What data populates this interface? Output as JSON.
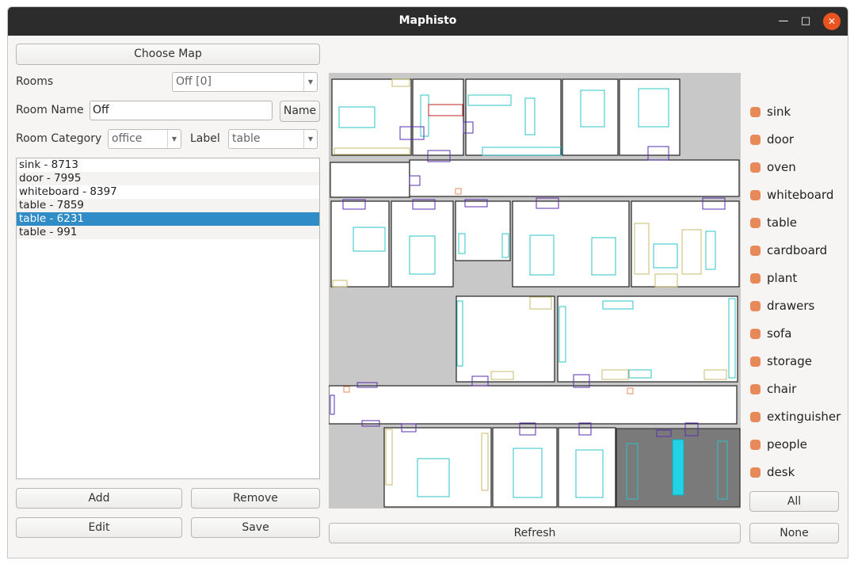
{
  "window": {
    "title": "Maphisto"
  },
  "controls": {
    "choose_map": "Choose Map",
    "rooms_label": "Rooms",
    "rooms_value": "Off [0]",
    "room_name_label": "Room Name",
    "room_name_value": "Off",
    "name_button": "Name",
    "room_category_label": "Room Category",
    "room_category_value": "office",
    "label_label": "Label",
    "label_value": "table"
  },
  "objects": [
    {
      "text": "sink - 8713"
    },
    {
      "text": "door - 7995"
    },
    {
      "text": "whiteboard - 8397"
    },
    {
      "text": "table - 7859"
    },
    {
      "text": "table - 6231",
      "selected": true
    },
    {
      "text": "table - 991"
    }
  ],
  "buttons": {
    "add": "Add",
    "remove": "Remove",
    "edit": "Edit",
    "save": "Save",
    "refresh": "Refresh",
    "all": "All",
    "none": "None"
  },
  "legend": [
    {
      "label": "sink"
    },
    {
      "label": "door"
    },
    {
      "label": "oven"
    },
    {
      "label": "whiteboard"
    },
    {
      "label": "table"
    },
    {
      "label": "cardboard"
    },
    {
      "label": "plant"
    },
    {
      "label": "drawers"
    },
    {
      "label": "sofa"
    },
    {
      "label": "storage"
    },
    {
      "label": "chair"
    },
    {
      "label": "extinguisher"
    },
    {
      "label": "people"
    },
    {
      "label": "desk"
    }
  ],
  "colors": {
    "legend_dot": "#e8895a",
    "selection": "#308cc6",
    "titlebar": "#2c2c2c",
    "close_button": "#e95420",
    "map_bg": "#c8c8c8",
    "highlighted_room": "#7a7a7a",
    "highlight_object": "#22d3e6"
  }
}
